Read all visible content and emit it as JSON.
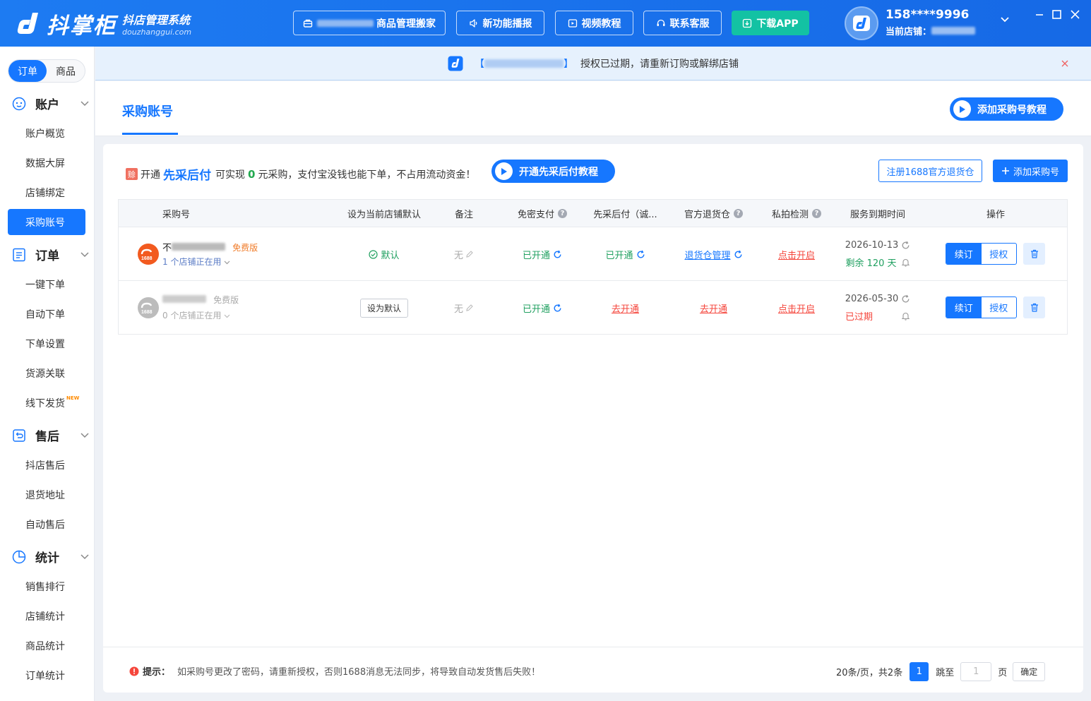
{
  "app": {
    "title": "抖掌柜",
    "subtitle": "抖店管理系统",
    "domain": "douzhanggui.com"
  },
  "topnav": {
    "product_move": "商品管理搬家",
    "new_features": "新功能播报",
    "video_tutorial": "视频教程",
    "contact": "联系客服",
    "download": "下载APP"
  },
  "user": {
    "phone": "158****9996",
    "store_label": "当前店铺："
  },
  "sidebar": {
    "tabs": [
      "订单",
      "商品"
    ],
    "groups": {
      "account": {
        "label": "账户",
        "items": [
          "账户概览",
          "数据大屏",
          "店铺绑定",
          "采购账号"
        ]
      },
      "order": {
        "label": "订单",
        "items": [
          "一键下单",
          "自动下单",
          "下单设置",
          "货源关联",
          "线下发货"
        ]
      },
      "aftersale": {
        "label": "售后",
        "items": [
          "抖店售后",
          "退货地址",
          "自动售后"
        ]
      },
      "stats": {
        "label": "统计",
        "items": [
          "销售排行",
          "店铺统计",
          "商品统计",
          "订单统计"
        ]
      }
    },
    "new_badge": "NEW"
  },
  "notice": {
    "bracket_open": "【",
    "bracket_close": "】",
    "text": "授权已过期，请重新订购或解绑店铺"
  },
  "page": {
    "title": "采购账号",
    "tutorial_btn": "添加采购号教程"
  },
  "promo": {
    "badge": "赊",
    "prefix": "开通",
    "pay_name": "先采后付",
    "mid1": "可实现",
    "zero": "0",
    "mid2": "元采购，支付宝没钱也能下单，不占用流动资金！",
    "button": "开通先采后付教程",
    "register": "注册1688官方退货仓",
    "add": "添加采购号"
  },
  "table": {
    "headers": [
      "采购号",
      "设为当前店铺默认",
      "备注",
      "免密支付",
      "先采后付（诚...",
      "官方退货仓",
      "私拍检测",
      "服务到期时间",
      "操作"
    ],
    "rows": [
      {
        "name_visible": "不",
        "edition": "免费版",
        "stores": "1 个店铺正在用",
        "default": "默认",
        "remark": "无",
        "mianmi": "已开通",
        "xiancai": "已开通",
        "tuihuo": "退货仓管理",
        "sipai": "点击开启",
        "expire_date": "2026-10-13",
        "expire_status": "剩余 120 天",
        "renew": "续订",
        "auth": "授权"
      },
      {
        "name_visible": "",
        "edition": "免费版",
        "stores": "0 个店铺正在用",
        "default": "设为默认",
        "remark": "无",
        "mianmi": "已开通",
        "xiancai": "去开通",
        "tuihuo": "去开通",
        "sipai": "点击开启",
        "expire_date": "2026-05-30",
        "expire_status": "已过期",
        "renew": "续订",
        "auth": "授权"
      }
    ]
  },
  "footer": {
    "tip_label": "提示：",
    "tip_text": "如采购号更改了密码，请重新授权，否则1688消息无法同步，将导致自动发货售后失败！",
    "pager_info": "20条/页，共2条",
    "page": "1",
    "jump_label": "跳至",
    "jump_placeholder": "1",
    "page_unit": "页",
    "confirm": "确定"
  },
  "colors": {
    "primary": "#1677ff",
    "success": "#20a060",
    "danger": "#f5463c",
    "download_bg": "#13c2a3"
  }
}
